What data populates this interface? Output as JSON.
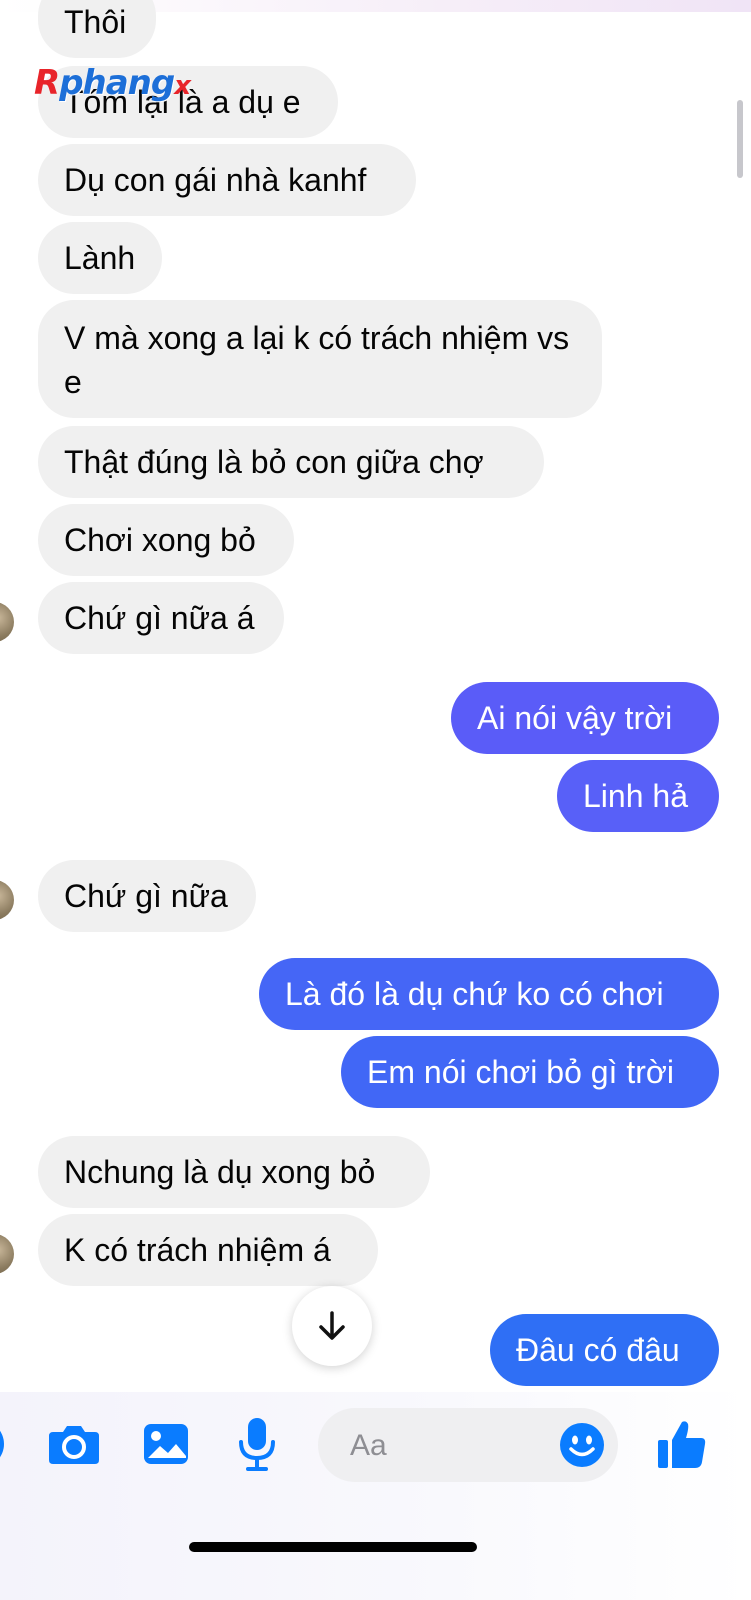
{
  "watermark": {
    "r": "R",
    "main": "phang",
    "x": "x"
  },
  "messages": [
    {
      "side": "in",
      "text": "Thôi"
    },
    {
      "side": "in",
      "text": "Tóm lại là a dụ e"
    },
    {
      "side": "in",
      "text": "Dụ con gái nhà kanhf"
    },
    {
      "side": "in",
      "text": "Lành"
    },
    {
      "side": "in",
      "text": "V mà xong a lại k có trách nhiệm vs e"
    },
    {
      "side": "in",
      "text": "Thật đúng là bỏ con giữa chợ"
    },
    {
      "side": "in",
      "text": "Chơi xong bỏ"
    },
    {
      "side": "in",
      "text": "Chứ gì nữa á"
    },
    {
      "side": "out",
      "text": "Ai nói  vậy trời"
    },
    {
      "side": "out",
      "text": "Linh hả"
    },
    {
      "side": "in",
      "text": "Chứ gì nữa"
    },
    {
      "side": "out",
      "text": "Là đó là dụ chứ ko có chơi"
    },
    {
      "side": "out",
      "text": "Em nói chơi bỏ gì trời"
    },
    {
      "side": "in",
      "text": "Nchung là dụ xong bỏ"
    },
    {
      "side": "in",
      "text": "K có trách nhiệm á"
    },
    {
      "side": "out",
      "text": "Đâu có đâu"
    }
  ],
  "composer": {
    "placeholder": "Aa",
    "icons": [
      "camera-icon",
      "photo-icon",
      "microphone-icon",
      "emoji-icon",
      "thumbs-up-icon"
    ]
  },
  "colors": {
    "incoming_bubble": "#f0f0f0",
    "outgoing_gradient": [
      "#3b6cf5",
      "#5b5cf7"
    ],
    "accent": "#0a7cff"
  }
}
